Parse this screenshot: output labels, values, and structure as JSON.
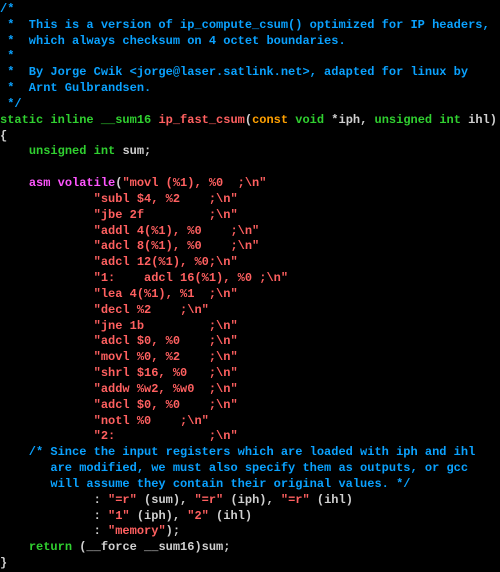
{
  "lines": [
    {
      "cls": "cmt",
      "text": "/*"
    },
    {
      "cls": "cmt",
      "text": " *  This is a version of ip_compute_csum() optimized for IP headers,"
    },
    {
      "cls": "cmt",
      "text": " *  which always checksum on 4 octet boundaries."
    },
    {
      "cls": "cmt",
      "text": " *"
    },
    {
      "cls": "cmt",
      "text": " *  By Jorge Cwik <jorge@laser.satlink.net>, adapted for linux by"
    },
    {
      "cls": "cmt",
      "text": " *  Arnt Gulbrandsen."
    },
    {
      "cls": "cmt",
      "text": " */"
    },
    {
      "segments": [
        {
          "cls": "kw",
          "text": "static inline "
        },
        {
          "cls": "type",
          "text": "__sum16 "
        },
        {
          "cls": "fn",
          "text": "ip_fast_csum"
        },
        {
          "cls": "id",
          "text": "("
        },
        {
          "cls": "const",
          "text": "const "
        },
        {
          "cls": "type",
          "text": "void "
        },
        {
          "cls": "id",
          "text": "*iph, "
        },
        {
          "cls": "type",
          "text": "unsigned int "
        },
        {
          "cls": "id",
          "text": "ihl)"
        }
      ]
    },
    {
      "cls": "id",
      "text": "{"
    },
    {
      "segments": [
        {
          "cls": "id",
          "text": "    "
        },
        {
          "cls": "type",
          "text": "unsigned int "
        },
        {
          "cls": "id",
          "text": "sum;"
        }
      ]
    },
    {
      "cls": "id",
      "text": ""
    },
    {
      "segments": [
        {
          "cls": "id",
          "text": "    "
        },
        {
          "cls": "kw2",
          "text": "asm volatile"
        },
        {
          "cls": "id",
          "text": "("
        },
        {
          "cls": "str",
          "text": "\"movl (%1), %0  ;\\n\""
        }
      ]
    },
    {
      "segments": [
        {
          "cls": "id",
          "text": "             "
        },
        {
          "cls": "str",
          "text": "\"subl $4, %2    ;\\n\""
        }
      ]
    },
    {
      "segments": [
        {
          "cls": "id",
          "text": "             "
        },
        {
          "cls": "str",
          "text": "\"jbe 2f         ;\\n\""
        }
      ]
    },
    {
      "segments": [
        {
          "cls": "id",
          "text": "             "
        },
        {
          "cls": "str",
          "text": "\"addl 4(%1), %0    ;\\n\""
        }
      ]
    },
    {
      "segments": [
        {
          "cls": "id",
          "text": "             "
        },
        {
          "cls": "str",
          "text": "\"adcl 8(%1), %0    ;\\n\""
        }
      ]
    },
    {
      "segments": [
        {
          "cls": "id",
          "text": "             "
        },
        {
          "cls": "str",
          "text": "\"adcl 12(%1), %0;\\n\""
        }
      ]
    },
    {
      "segments": [
        {
          "cls": "id",
          "text": "             "
        },
        {
          "cls": "str",
          "text": "\"1:    adcl 16(%1), %0 ;\\n\""
        }
      ]
    },
    {
      "segments": [
        {
          "cls": "id",
          "text": "             "
        },
        {
          "cls": "str",
          "text": "\"lea 4(%1), %1  ;\\n\""
        }
      ]
    },
    {
      "segments": [
        {
          "cls": "id",
          "text": "             "
        },
        {
          "cls": "str",
          "text": "\"decl %2    ;\\n\""
        }
      ]
    },
    {
      "segments": [
        {
          "cls": "id",
          "text": "             "
        },
        {
          "cls": "str",
          "text": "\"jne 1b         ;\\n\""
        }
      ]
    },
    {
      "segments": [
        {
          "cls": "id",
          "text": "             "
        },
        {
          "cls": "str",
          "text": "\"adcl $0, %0    ;\\n\""
        }
      ]
    },
    {
      "segments": [
        {
          "cls": "id",
          "text": "             "
        },
        {
          "cls": "str",
          "text": "\"movl %0, %2    ;\\n\""
        }
      ]
    },
    {
      "segments": [
        {
          "cls": "id",
          "text": "             "
        },
        {
          "cls": "str",
          "text": "\"shrl $16, %0   ;\\n\""
        }
      ]
    },
    {
      "segments": [
        {
          "cls": "id",
          "text": "             "
        },
        {
          "cls": "str",
          "text": "\"addw %w2, %w0  ;\\n\""
        }
      ]
    },
    {
      "segments": [
        {
          "cls": "id",
          "text": "             "
        },
        {
          "cls": "str",
          "text": "\"adcl $0, %0    ;\\n\""
        }
      ]
    },
    {
      "segments": [
        {
          "cls": "id",
          "text": "             "
        },
        {
          "cls": "str",
          "text": "\"notl %0    ;\\n\""
        }
      ]
    },
    {
      "segments": [
        {
          "cls": "id",
          "text": "             "
        },
        {
          "cls": "str",
          "text": "\"2:             ;\\n\""
        }
      ]
    },
    {
      "cls": "cmt",
      "text": "    /* Since the input registers which are loaded with iph and ihl"
    },
    {
      "cls": "cmt",
      "text": "       are modified, we must also specify them as outputs, or gcc"
    },
    {
      "cls": "cmt",
      "text": "       will assume they contain their original values. */"
    },
    {
      "segments": [
        {
          "cls": "id",
          "text": "             : "
        },
        {
          "cls": "str",
          "text": "\"=r\""
        },
        {
          "cls": "id",
          "text": " (sum), "
        },
        {
          "cls": "str",
          "text": "\"=r\""
        },
        {
          "cls": "id",
          "text": " (iph), "
        },
        {
          "cls": "str",
          "text": "\"=r\""
        },
        {
          "cls": "id",
          "text": " (ihl)"
        }
      ]
    },
    {
      "segments": [
        {
          "cls": "id",
          "text": "             : "
        },
        {
          "cls": "str",
          "text": "\"1\""
        },
        {
          "cls": "id",
          "text": " (iph), "
        },
        {
          "cls": "str",
          "text": "\"2\""
        },
        {
          "cls": "id",
          "text": " (ihl)"
        }
      ]
    },
    {
      "segments": [
        {
          "cls": "id",
          "text": "             : "
        },
        {
          "cls": "str",
          "text": "\"memory\""
        },
        {
          "cls": "id",
          "text": ");"
        }
      ]
    },
    {
      "segments": [
        {
          "cls": "id",
          "text": "    "
        },
        {
          "cls": "kw",
          "text": "return "
        },
        {
          "cls": "id",
          "text": "(__force __sum16)sum;"
        }
      ]
    },
    {
      "cls": "id",
      "text": "}"
    }
  ]
}
